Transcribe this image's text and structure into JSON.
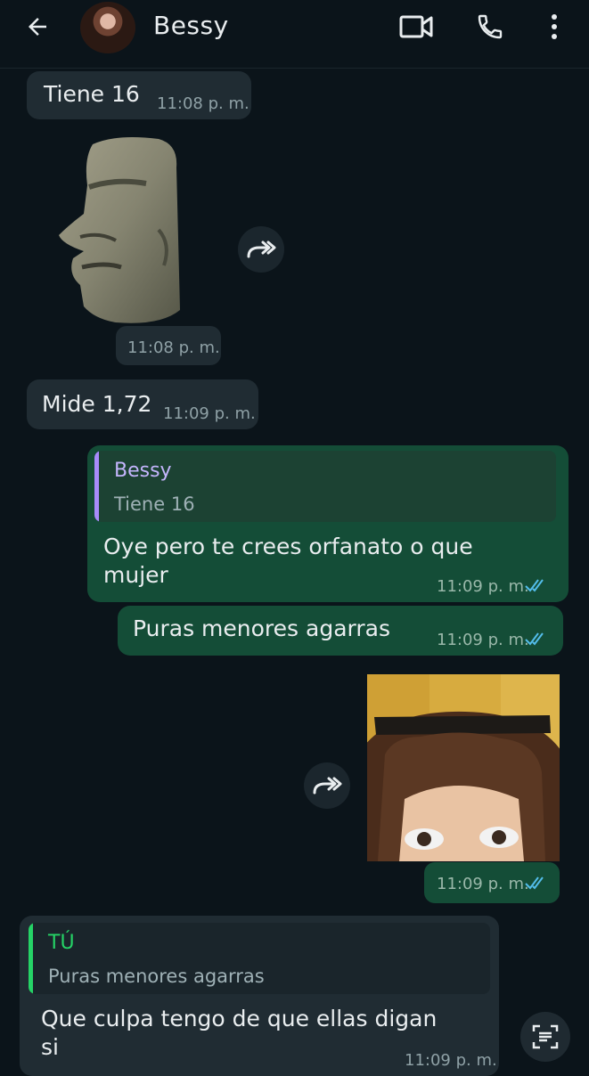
{
  "header": {
    "contact_name": "Bessy"
  },
  "messages": [
    {
      "id": "m1",
      "direction": "incoming",
      "text": "Tiene 16",
      "time": "11:08 p. m."
    },
    {
      "id": "m2",
      "direction": "incoming",
      "type": "sticker",
      "sticker": "moai-statue",
      "time": "11:08 p. m."
    },
    {
      "id": "m3",
      "direction": "incoming",
      "text": "Mide 1,72",
      "time": "11:09 p. m."
    },
    {
      "id": "m4",
      "direction": "outgoing",
      "reply_to": {
        "author": "Bessy",
        "text": "Tiene 16"
      },
      "text": "Oye pero te crees orfanato o que mujer",
      "text_line1": "Oye pero te crees orfanato o que",
      "text_line2": "mujer",
      "time": "11:09 p. m.",
      "status": "read"
    },
    {
      "id": "m5",
      "direction": "outgoing",
      "text": "Puras menores agarras",
      "time": "11:09 p. m.",
      "status": "read"
    },
    {
      "id": "m6",
      "direction": "outgoing",
      "type": "image",
      "time": "11:09 p. m.",
      "status": "read"
    },
    {
      "id": "m7",
      "direction": "incoming",
      "reply_to": {
        "author": "TÚ",
        "text": "Puras menores agarras"
      },
      "text": "Que culpa tengo de que ellas digan si",
      "text_line1": "Que culpa tengo de que ellas digan",
      "text_line2": "si",
      "time": "11:09 p. m."
    }
  ],
  "icons": {
    "back": "arrow-left-icon",
    "video": "video-call-icon",
    "phone": "phone-icon",
    "more": "more-vertical-icon",
    "forward": "forward-icon",
    "read": "double-check-icon",
    "scan": "text-scan-icon"
  },
  "colors": {
    "background": "#0b141a",
    "incoming_bubble": "#202c33",
    "outgoing_bubble": "#144d37",
    "read_tick": "#53bdeb",
    "quote_bessy": "#a78bfa",
    "quote_you": "#25d366"
  }
}
